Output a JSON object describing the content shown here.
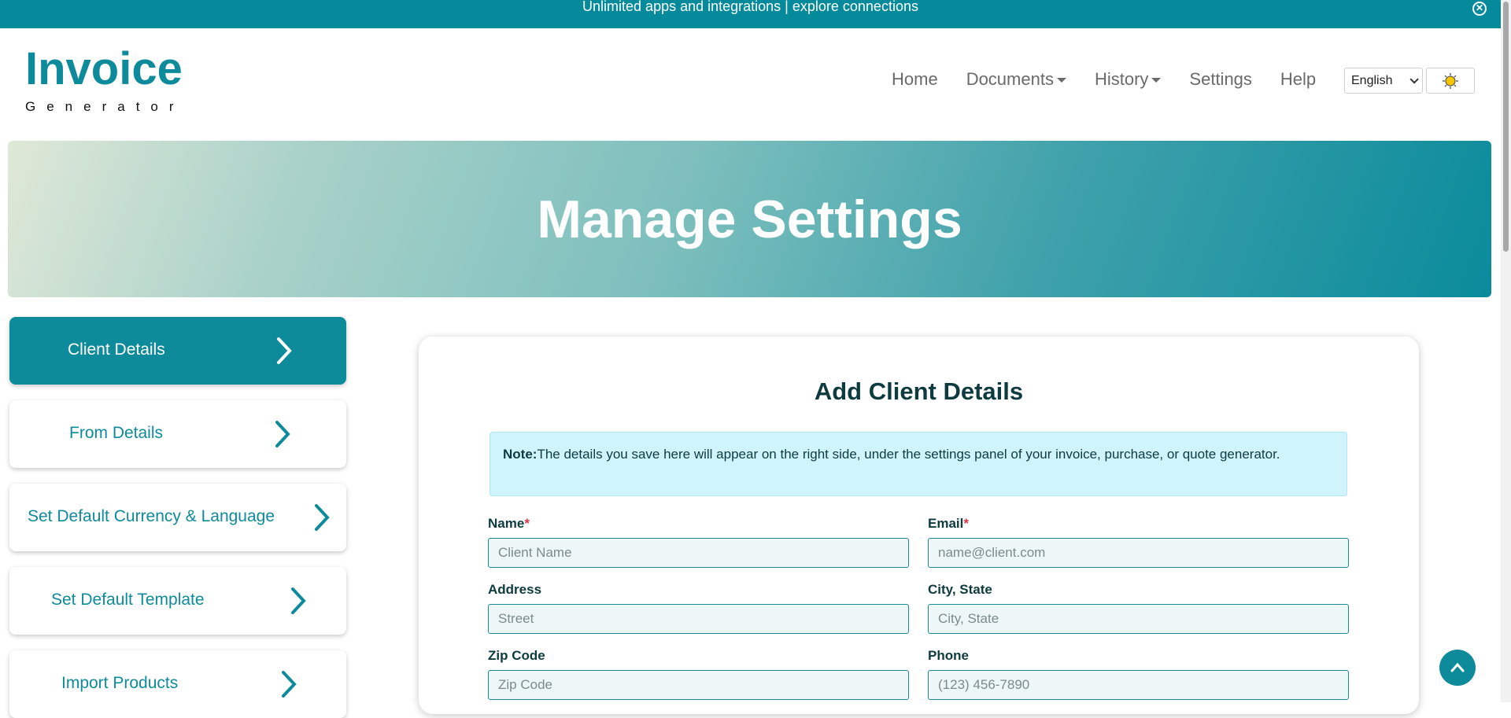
{
  "topbar": {
    "text": "Unlimited apps and integrations | explore connections"
  },
  "logo": {
    "title": "Invoice",
    "subtitle": "Generator"
  },
  "nav": {
    "home": "Home",
    "documents": "Documents",
    "history": "History",
    "settings": "Settings",
    "help": "Help"
  },
  "language": {
    "selected": "English"
  },
  "hero": {
    "title": "Manage Settings"
  },
  "sidebar": {
    "items": [
      {
        "label": "Client Details"
      },
      {
        "label": "From Details"
      },
      {
        "label": "Set Default Currency & Language"
      },
      {
        "label": "Set Default Template"
      },
      {
        "label": "Import Products"
      }
    ]
  },
  "form": {
    "title": "Add Client Details",
    "note_prefix": "Note:",
    "note_text": "The details you save here will appear on the right side, under the settings panel of your invoice, purchase, or quote generator.",
    "required_mark": "*",
    "fields": {
      "name": {
        "label": "Name",
        "placeholder": "Client Name"
      },
      "email": {
        "label": "Email",
        "placeholder": "name@client.com"
      },
      "address": {
        "label": "Address",
        "placeholder": "Street"
      },
      "city": {
        "label": "City, State",
        "placeholder": "City, State"
      },
      "zip": {
        "label": "Zip Code",
        "placeholder": "Zip Code"
      },
      "phone": {
        "label": "Phone",
        "placeholder": "(123) 456-7890"
      }
    }
  },
  "colors": {
    "brand": "#0e8b9b",
    "topbar": "#048a9b",
    "note_bg": "#cff4fc",
    "required": "#dc3545"
  }
}
